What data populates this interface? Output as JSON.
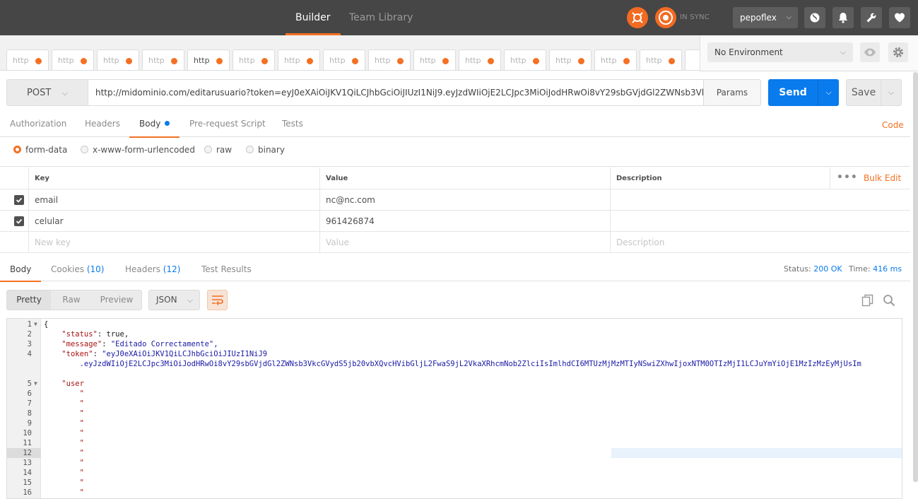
{
  "header": {
    "tabs": [
      {
        "label": "Builder",
        "active": true
      },
      {
        "label": "Team Library",
        "active": false
      }
    ],
    "sync_status": "IN SYNC",
    "user": "pepoflex",
    "accent_color": "#f47023"
  },
  "request_tabs": [
    {
      "label": "http",
      "active": false
    },
    {
      "label": "http",
      "active": false
    },
    {
      "label": "http",
      "active": false
    },
    {
      "label": "http",
      "active": false
    },
    {
      "label": "http",
      "active": true
    },
    {
      "label": "http",
      "active": false
    },
    {
      "label": "http",
      "active": false
    },
    {
      "label": "http",
      "active": false
    },
    {
      "label": "http",
      "active": false
    },
    {
      "label": "http",
      "active": false
    },
    {
      "label": "http",
      "active": false
    },
    {
      "label": "http",
      "active": false
    },
    {
      "label": "http",
      "active": false
    },
    {
      "label": "http",
      "active": false
    },
    {
      "label": "http",
      "active": false
    }
  ],
  "environment": {
    "selected": "No Environment"
  },
  "request": {
    "method": "POST",
    "url": "http://midominio.com/editarusuario?token=eyJ0eXAiOiJKV1QiLCJhbGciOiJIUzI1NiJ9.eyJzdWIiOjE2LCJpc3MiOiJodHRwOi8vY29sbGVjdGl2ZWNsb3VkcGVyd...",
    "params_label": "Params",
    "send_label": "Send",
    "save_label": "Save"
  },
  "request_subtabs": {
    "items": [
      {
        "label": "Authorization",
        "active": false
      },
      {
        "label": "Headers",
        "active": false
      },
      {
        "label": "Body",
        "active": true
      },
      {
        "label": "Pre-request Script",
        "active": false
      },
      {
        "label": "Tests",
        "active": false
      }
    ],
    "code_label": "Code"
  },
  "body_types": [
    {
      "label": "form-data",
      "selected": true
    },
    {
      "label": "x-www-form-urlencoded",
      "selected": false
    },
    {
      "label": "raw",
      "selected": false
    },
    {
      "label": "binary",
      "selected": false
    }
  ],
  "kv_table": {
    "headers": {
      "key": "Key",
      "value": "Value",
      "description": "Description",
      "bulk_edit": "Bulk Edit"
    },
    "rows": [
      {
        "checked": true,
        "key": "email",
        "value": "nc@nc.com",
        "description": ""
      },
      {
        "checked": true,
        "key": "celular",
        "value": "961426874",
        "description": ""
      }
    ],
    "placeholders": {
      "key": "New key",
      "value": "Value",
      "description": "Description"
    }
  },
  "response": {
    "tabs": [
      {
        "label": "Body",
        "count": "",
        "active": true
      },
      {
        "label": "Cookies",
        "count": "(10)",
        "active": false
      },
      {
        "label": "Headers",
        "count": "(12)",
        "active": false
      },
      {
        "label": "Test Results",
        "count": "",
        "active": false
      }
    ],
    "status_label": "Status:",
    "status_value": "200 OK",
    "time_label": "Time:",
    "time_value": "416 ms",
    "format_buttons": [
      {
        "label": "Pretty",
        "active": true
      },
      {
        "label": "Raw",
        "active": false
      },
      {
        "label": "Preview",
        "active": false
      }
    ],
    "language": "JSON"
  },
  "code_lines": [
    {
      "n": "1",
      "fold": true
    },
    {
      "n": "2"
    },
    {
      "n": "3"
    },
    {
      "n": "4"
    },
    {
      "n": "5",
      "fold": true
    },
    {
      "n": "6"
    },
    {
      "n": "7"
    },
    {
      "n": "8"
    },
    {
      "n": "9"
    },
    {
      "n": "10"
    },
    {
      "n": "11"
    },
    {
      "n": "12",
      "highlight": true
    },
    {
      "n": "13"
    },
    {
      "n": "14"
    },
    {
      "n": "15"
    },
    {
      "n": "16"
    }
  ],
  "code_text": {
    "l1": "{",
    "status_key": "\"status\"",
    "status_val": "true,",
    "message_key": "\"message\"",
    "message_val": "\"Editado Correctamente\",",
    "token_key": "\"token\"",
    "token_val_1": "\"eyJ0eXAiOiJKV1QiLCJhbGciOiJIUzI1NiJ9",
    "token_val_2": ".eyJzdWIiOjE2LCJpc3MiOiJodHRwOi8vY29sbGVjdGl2ZWNsb3VkcGVydS5jb20vbXQvcHVibGljL2FwaS9jL2VkaXRhcmNob2ZlciIsImlhdCI6MTUzMjMzMTIyNSwiZXhwIjoxNTM0OTIzMjI1LCJuYmYiOjE1MzIzMzEyMjUsIm",
    "user_key": "\"user"
  }
}
